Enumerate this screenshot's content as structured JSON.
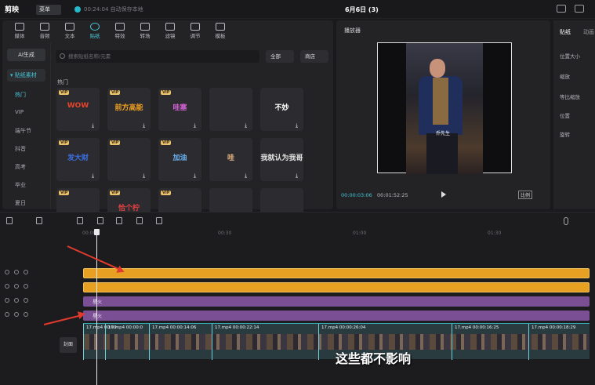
{
  "app": {
    "logo": "剪映",
    "menu_label": "菜单",
    "save_status": "00:24:04 自动保存本地",
    "doc_title": "6月6日 (3)"
  },
  "toolbar": {
    "tools": [
      {
        "label": "媒体",
        "icon": "media-icon"
      },
      {
        "label": "音频",
        "icon": "audio-icon"
      },
      {
        "label": "文本",
        "icon": "text-icon"
      },
      {
        "label": "贴纸",
        "icon": "sticker-icon",
        "active": true
      },
      {
        "label": "特效",
        "icon": "effects-icon"
      },
      {
        "label": "转场",
        "icon": "transition-icon"
      },
      {
        "label": "滤镜",
        "icon": "filter-icon"
      },
      {
        "label": "调节",
        "icon": "adjust-icon"
      },
      {
        "label": "模板",
        "icon": "template-icon"
      }
    ]
  },
  "sidebar": {
    "ai_label": "AI生成",
    "category_label": "▾ 贴纸素材",
    "items": [
      "热门",
      "VIP",
      "端午节",
      "抖音",
      "高考",
      "毕业",
      "夏日"
    ]
  },
  "search": {
    "placeholder": "搜索贴纸名称/元素",
    "filter_label": "全部",
    "store_label": "商店"
  },
  "section": {
    "hot_label": "热门"
  },
  "stickers": [
    {
      "text": "WOW",
      "vip": true,
      "color": "#e8442a"
    },
    {
      "text": "前方高能",
      "vip": true,
      "color": "#f0a020"
    },
    {
      "text": "哇塞",
      "vip": true,
      "color": "#d060d0"
    },
    {
      "text": "",
      "vip": false,
      "color": "#555"
    },
    {
      "text": "不妙",
      "vip": false,
      "color": "#fff"
    },
    {
      "text": "发大财",
      "vip": true,
      "color": "#3a6ee0"
    },
    {
      "text": "",
      "vip": true,
      "color": "#f4b818"
    },
    {
      "text": "加油",
      "vip": true,
      "color": "#6ab0f0"
    },
    {
      "text": "哇",
      "vip": false,
      "color": "#e0b080"
    },
    {
      "text": "我就认为我哥",
      "vip": false,
      "color": "#e0e0e0"
    },
    {
      "text": "",
      "vip": true,
      "color": "#e0a040"
    },
    {
      "text": "恰个柠",
      "vip": true,
      "color": "#e04040"
    },
    {
      "text": "",
      "vip": true,
      "color": "#f0c040"
    },
    {
      "text": "",
      "vip": false,
      "color": "#f0b0b8"
    },
    {
      "text": "",
      "vip": false,
      "color": "#ddd"
    }
  ],
  "player": {
    "title": "播放器",
    "current_time": "00:00:03:06",
    "total_time": "00:01:52:25",
    "ratio_label": "比例",
    "video_caption": "乔先生"
  },
  "properties": {
    "tab1": "贴纸",
    "tab2": "动画",
    "rows": [
      "位置大小",
      "缩放",
      "等比缩放",
      "位置",
      "旋转"
    ]
  },
  "timeline": {
    "ruler": [
      "00:00",
      "00:30",
      "01:00",
      "01:30"
    ],
    "tracks": [
      {
        "type": "sticker",
        "label": ""
      },
      {
        "type": "sticker",
        "label": ""
      },
      {
        "type": "effect",
        "label": "星火"
      },
      {
        "type": "effect",
        "label": "星火"
      }
    ],
    "cover_label": "封面",
    "video_segments": [
      "17.mp4  00:00",
      "17.mp4  00:00:0",
      "17.mp4  00:00:14:06",
      "17.mp4  00:00:22:14",
      "17.mp4  00:00:26:04",
      "17.mp4  00:00:16:25",
      "17.mp4  00:00:18:29"
    ],
    "subtitle": "这些都不影响"
  }
}
